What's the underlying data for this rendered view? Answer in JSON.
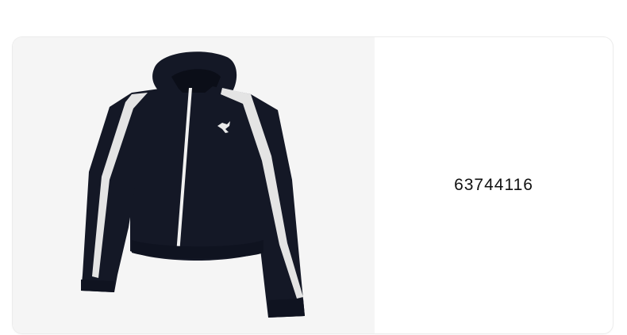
{
  "product": {
    "code": "63744116",
    "image_icon": "jacket-product-image",
    "logo_icon": "puma-logo-icon"
  },
  "colors": {
    "jacket": "#141826",
    "stripe": "#e4e4e4",
    "panel_bg": "#f5f5f5",
    "text": "#111111"
  }
}
